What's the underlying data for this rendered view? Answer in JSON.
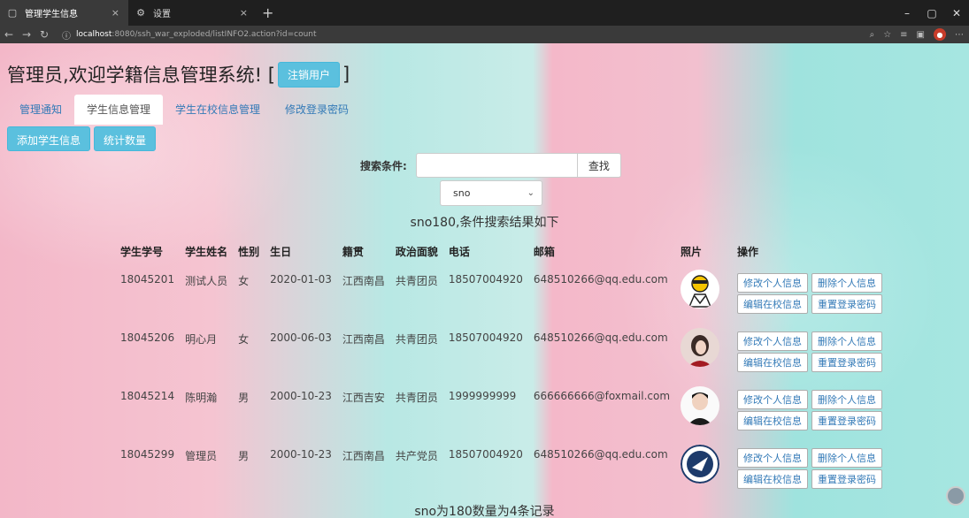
{
  "browser": {
    "tabs": [
      {
        "label": "管理学生信息",
        "close": "×"
      },
      {
        "label": "设置",
        "close": "×"
      }
    ],
    "newtab": "+",
    "url_host": "localhost",
    "url_path": ":8080/ssh_war_exploded/listINFO2.action?id=count",
    "window": {
      "minimize": "–",
      "maximize": "▢",
      "close": "✕"
    }
  },
  "header": {
    "title": "管理员,欢迎学籍信息管理系统! [",
    "logout": "注销用户",
    "close_bracket": "]"
  },
  "tabs": [
    {
      "label": "管理通知"
    },
    {
      "label": "学生信息管理"
    },
    {
      "label": "学生在校信息管理"
    },
    {
      "label": "修改登录密码"
    }
  ],
  "actions": {
    "add": "添加学生信息",
    "count": "统计数量"
  },
  "search": {
    "label": "搜索条件:",
    "value": "",
    "button": "查找",
    "select": "sno"
  },
  "result_title": "sno180,条件搜索结果如下",
  "result_footer": "sno为180数量为4条记录",
  "table": {
    "headers": [
      "学生学号",
      "学生姓名",
      "性别",
      "生日",
      "籍贯",
      "政治面貌",
      "电话",
      "邮箱",
      "照片",
      "操作"
    ],
    "rows": [
      {
        "sno": "18045201",
        "name": "测试人员",
        "sex": "女",
        "birthday": "2020-01-03",
        "origin": "江西南昌",
        "politics": "共青团员",
        "phone": "18507004920",
        "email": "648510266@qq.edu.com"
      },
      {
        "sno": "18045206",
        "name": "明心月",
        "sex": "女",
        "birthday": "2000-06-03",
        "origin": "江西南昌",
        "politics": "共青团员",
        "phone": "18507004920",
        "email": "648510266@qq.edu.com"
      },
      {
        "sno": "18045214",
        "name": "陈明瀚",
        "sex": "男",
        "birthday": "2000-10-23",
        "origin": "江西吉安",
        "politics": "共青团员",
        "phone": "1999999999",
        "email": "666666666@foxmail.com"
      },
      {
        "sno": "18045299",
        "name": "管理员",
        "sex": "男",
        "birthday": "2000-10-23",
        "origin": "江西南昌",
        "politics": "共产党员",
        "phone": "18507004920",
        "email": "648510266@qq.edu.com"
      }
    ],
    "ops": [
      "修改个人信息",
      "删除个人信息",
      "编辑在校信息",
      "重置登录密码"
    ]
  }
}
